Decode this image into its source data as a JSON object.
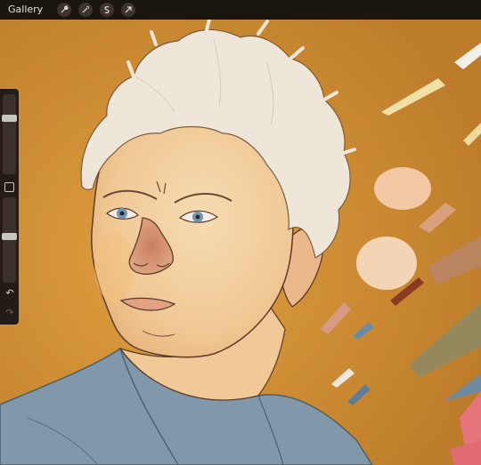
{
  "topbar": {
    "gallery_label": "Gallery",
    "tools": [
      {
        "icon": "wrench-icon"
      },
      {
        "icon": "magic-wand-icon"
      },
      {
        "icon": "selection-s-icon"
      },
      {
        "icon": "transform-arrow-icon"
      }
    ]
  },
  "sidebar": {
    "brush_size_level": 0.28,
    "opacity_level": 0.55,
    "modify_icon": "square-icon",
    "undo_icon": "undo-arrow-icon",
    "redo_icon": "redo-arrow-icon",
    "undo_glyph": "↶",
    "redo_glyph": "↷"
  },
  "colors": {
    "background": "#c6862f",
    "skin": "#f2cfa1",
    "skin_shadow": "#dca27a",
    "hair": "#efe7dc",
    "shirt": "#7f97a8",
    "outline": "#5a3b2a",
    "eye": "#6e95b6",
    "topbar": "#1b1510"
  }
}
